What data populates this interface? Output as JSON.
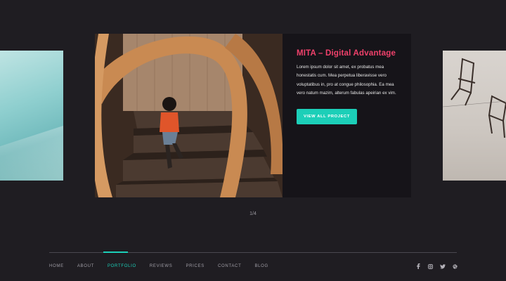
{
  "slide": {
    "title": "MITA – Digital Advantage",
    "description": "Lorem ipsum dolor sit amet, ex probatus mea honestatis cum. Mea perpetua liberavisse vero voluptatibus in, pro at congue philosophia. Ea mea vero natum mazim, alterum fabulas apeirian ex vim.",
    "button_label": "VIEW ALL PROJECT"
  },
  "pager": "1/4",
  "nav": {
    "home": "HOME",
    "about": "ABOUT",
    "portfolio": "PORTFOLIO",
    "reviews": "REVIEWS",
    "prices": "PRICES",
    "contact": "CONTACT",
    "blog": "BLOG"
  },
  "active_nav": "PORTFOLIO",
  "social_icons": [
    "facebook-icon",
    "instagram-icon",
    "twitter-icon",
    "dribbble-icon"
  ],
  "colors": {
    "accent": "#1ccfb8",
    "title": "#f0416b",
    "background": "#1f1d22"
  }
}
